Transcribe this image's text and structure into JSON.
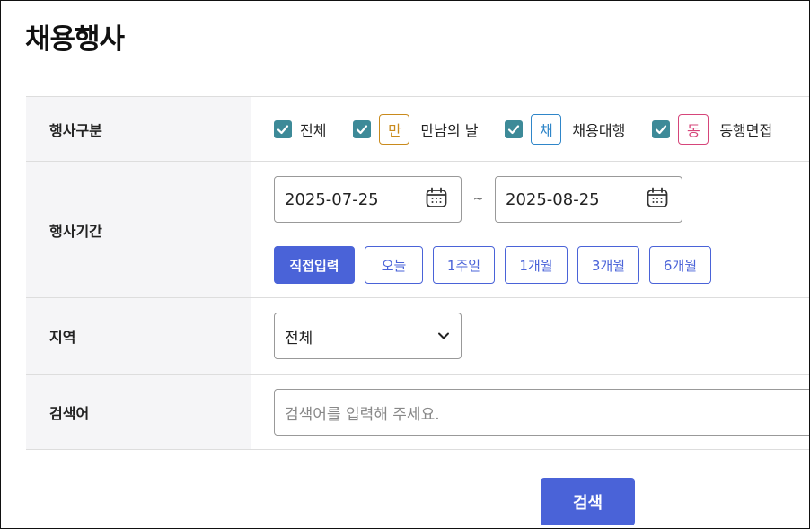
{
  "page": {
    "title": "채용행사"
  },
  "event_type": {
    "label": "행사구분",
    "options": [
      {
        "label": "전체",
        "checked": true,
        "tag": "",
        "tag_color": ""
      },
      {
        "label": "만남의 날",
        "checked": true,
        "tag": "만",
        "tag_color": "#c98a1c"
      },
      {
        "label": "채용대행",
        "checked": true,
        "tag": "채",
        "tag_color": "#2f86c9"
      },
      {
        "label": "동행면접",
        "checked": true,
        "tag": "동",
        "tag_color": "#d6457a"
      }
    ]
  },
  "event_period": {
    "label": "행사기간",
    "start_date": "2025-07-25",
    "separator": "~",
    "end_date": "2025-08-25",
    "presets": [
      {
        "label": "직접입력",
        "active": true
      },
      {
        "label": "오늘",
        "active": false
      },
      {
        "label": "1주일",
        "active": false
      },
      {
        "label": "1개월",
        "active": false
      },
      {
        "label": "3개월",
        "active": false
      },
      {
        "label": "6개월",
        "active": false
      }
    ]
  },
  "region": {
    "label": "지역",
    "selected": "전체"
  },
  "keyword": {
    "label": "검색어",
    "placeholder": "검색어를 입력해 주세요."
  },
  "search_button": {
    "label": "검색"
  },
  "colors": {
    "accent": "#4a63d8",
    "checkbox": "#3d8a98",
    "label_bg": "#f5f5f7"
  }
}
